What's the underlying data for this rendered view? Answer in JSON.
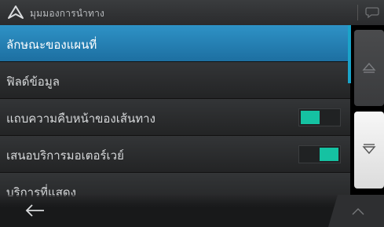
{
  "header": {
    "title": "มุมมองการนำทาง",
    "logo_icon": "navigation-arrow-icon",
    "chat_icon": "speech-bubble-icon"
  },
  "list": {
    "items": [
      {
        "label": "ลักษณะของแผนที่",
        "selected": true
      },
      {
        "label": "ฟิลด์ข้อมูล"
      },
      {
        "label": "แถบความคืบหน้าของเส้นทาง",
        "toggle": "off"
      },
      {
        "label": "เสนอบริการมอเตอร์เวย์",
        "toggle": "on"
      },
      {
        "label": "บริการที่แสดง"
      }
    ]
  },
  "side": {
    "up_icon": "scroll-up-icon",
    "down_icon": "scroll-down-icon"
  },
  "bottom": {
    "back_icon": "back-arrow-icon",
    "chevron_icon": "chevron-up-icon"
  },
  "colors": {
    "accent": "#1aa4c9",
    "selected_row": "#2285b8",
    "toggle_on": "#15c2a2"
  }
}
